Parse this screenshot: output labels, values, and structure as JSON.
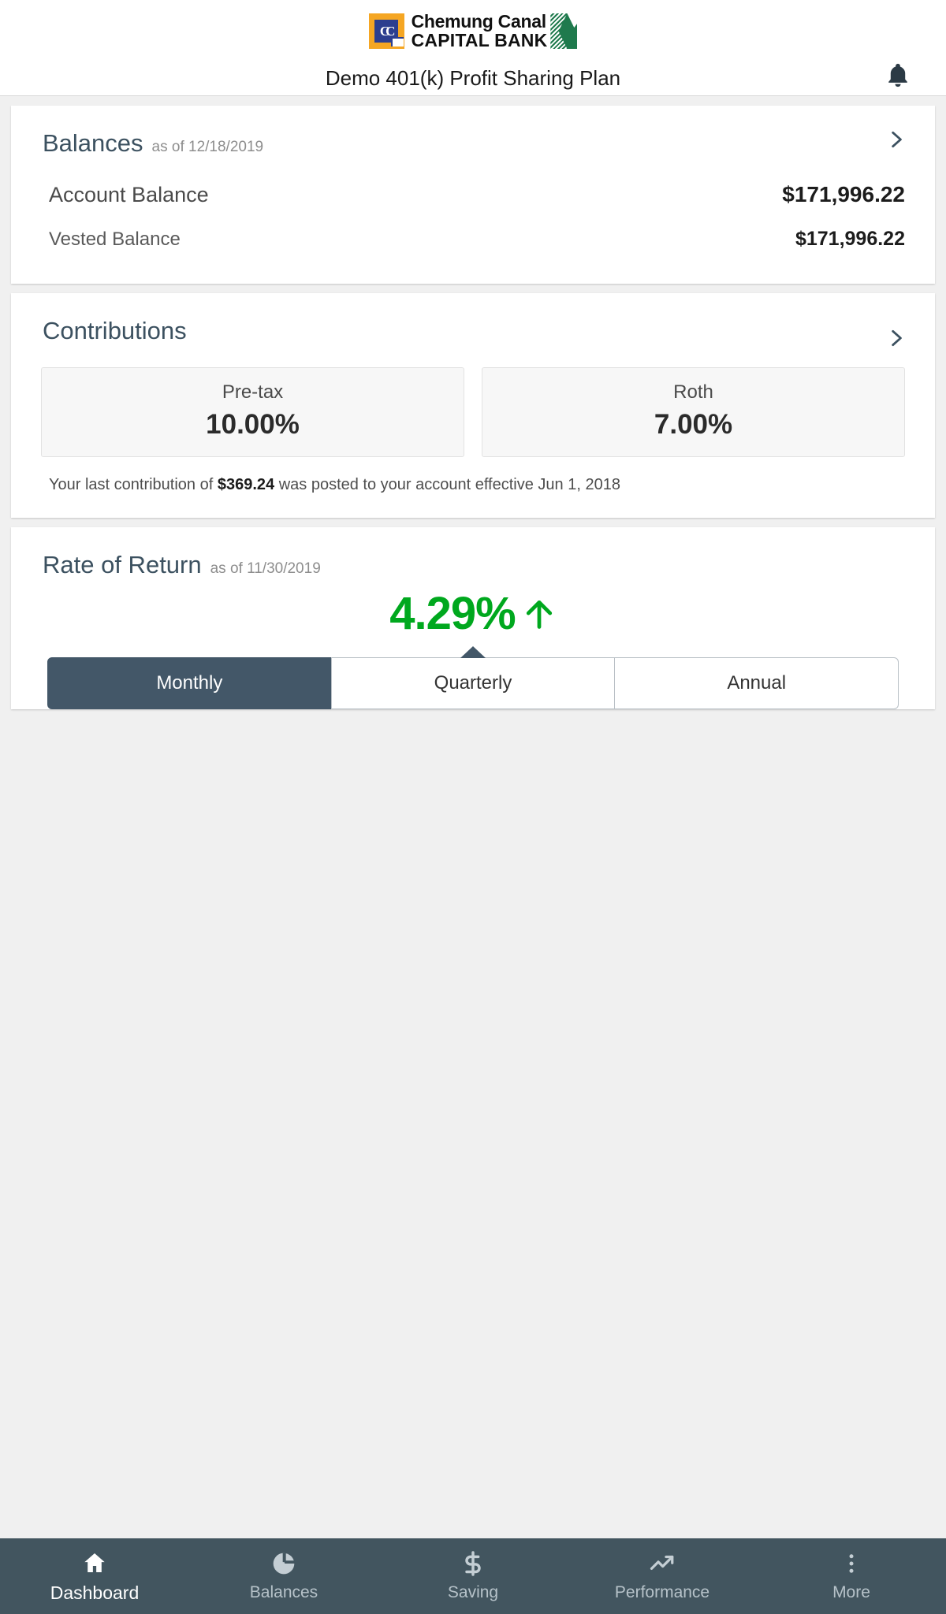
{
  "header": {
    "logo": {
      "mark_text": "CC",
      "line1": "Chemung Canal",
      "line2": "CAPITAL BANK",
      "mark_bg": "#F5A623",
      "mark_fg": "#2c3e8f",
      "flag_color": "#1f7a4d"
    },
    "plan_title": "Demo 401(k) Profit Sharing Plan",
    "notification_icon": "bell-icon"
  },
  "balances": {
    "title": "Balances",
    "as_of": "as of 12/18/2019",
    "chevron_icon": "chevron-right-icon",
    "rows": [
      {
        "label": "Account Balance",
        "amount": "$171,996.22"
      },
      {
        "label": "Vested Balance",
        "amount": "$171,996.22"
      }
    ]
  },
  "contributions": {
    "title": "Contributions",
    "chevron_icon": "chevron-right-icon",
    "boxes": [
      {
        "label": "Pre-tax",
        "value": "10.00%"
      },
      {
        "label": "Roth",
        "value": "7.00%"
      }
    ],
    "note_prefix": "Your last contribution of ",
    "note_amount": "$369.24",
    "note_suffix": " was posted to your account effective Jun 1, 2018"
  },
  "rate_of_return": {
    "title": "Rate of Return",
    "as_of": "as of 11/30/2019",
    "value": "4.29%",
    "trend_icon": "arrow-up-icon",
    "trend_color": "#00a81e",
    "periods": [
      {
        "label": "Monthly",
        "active": true
      },
      {
        "label": "Quarterly",
        "active": false
      },
      {
        "label": "Annual",
        "active": false
      }
    ]
  },
  "bottom_nav": {
    "items": [
      {
        "label": "Dashboard",
        "icon": "home-icon",
        "active": true
      },
      {
        "label": "Balances",
        "icon": "pie-chart-icon",
        "active": false
      },
      {
        "label": "Saving",
        "icon": "dollar-sign-icon",
        "active": false
      },
      {
        "label": "Performance",
        "icon": "trending-up-icon",
        "active": false
      },
      {
        "label": "More",
        "icon": "more-vertical-icon",
        "active": false
      }
    ]
  }
}
